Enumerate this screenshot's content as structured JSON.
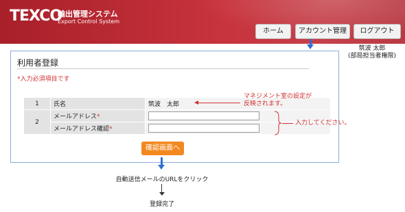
{
  "header": {
    "logo": "TEXCO",
    "system_name_jp": "輸出管理システム",
    "system_name_en": "Export Control System",
    "nav": [
      {
        "label": "ホーム"
      },
      {
        "label": "アカウント管理"
      },
      {
        "label": "ログアウト"
      }
    ]
  },
  "user": {
    "name": "筑波 太郎",
    "role": "(部局担当者権限)"
  },
  "form": {
    "title": "利用者登録",
    "required_note": "*入力必須項目です",
    "rows": [
      {
        "num": "1",
        "label": "氏名",
        "value": "筑波　太郎"
      },
      {
        "num": "2",
        "label": "メールアドレス",
        "required_mark": "*",
        "value": ""
      },
      {
        "label": "メールアドレス確認",
        "required_mark": "*",
        "value": ""
      }
    ],
    "confirm_button": "確認画面へ"
  },
  "annotations": {
    "management_note_line1": "マネジメント室の設定が",
    "management_note_line2": "反映されます。",
    "input_note": "入力してください。"
  },
  "steps": {
    "step1": "自動送信メールのURLをクリック",
    "step2": "登録完了"
  },
  "colors": {
    "header_red": "#b62a33",
    "accent_orange": "#f2881f",
    "arrow_blue": "#2e6fd1",
    "annotation_red": "#d03030"
  }
}
